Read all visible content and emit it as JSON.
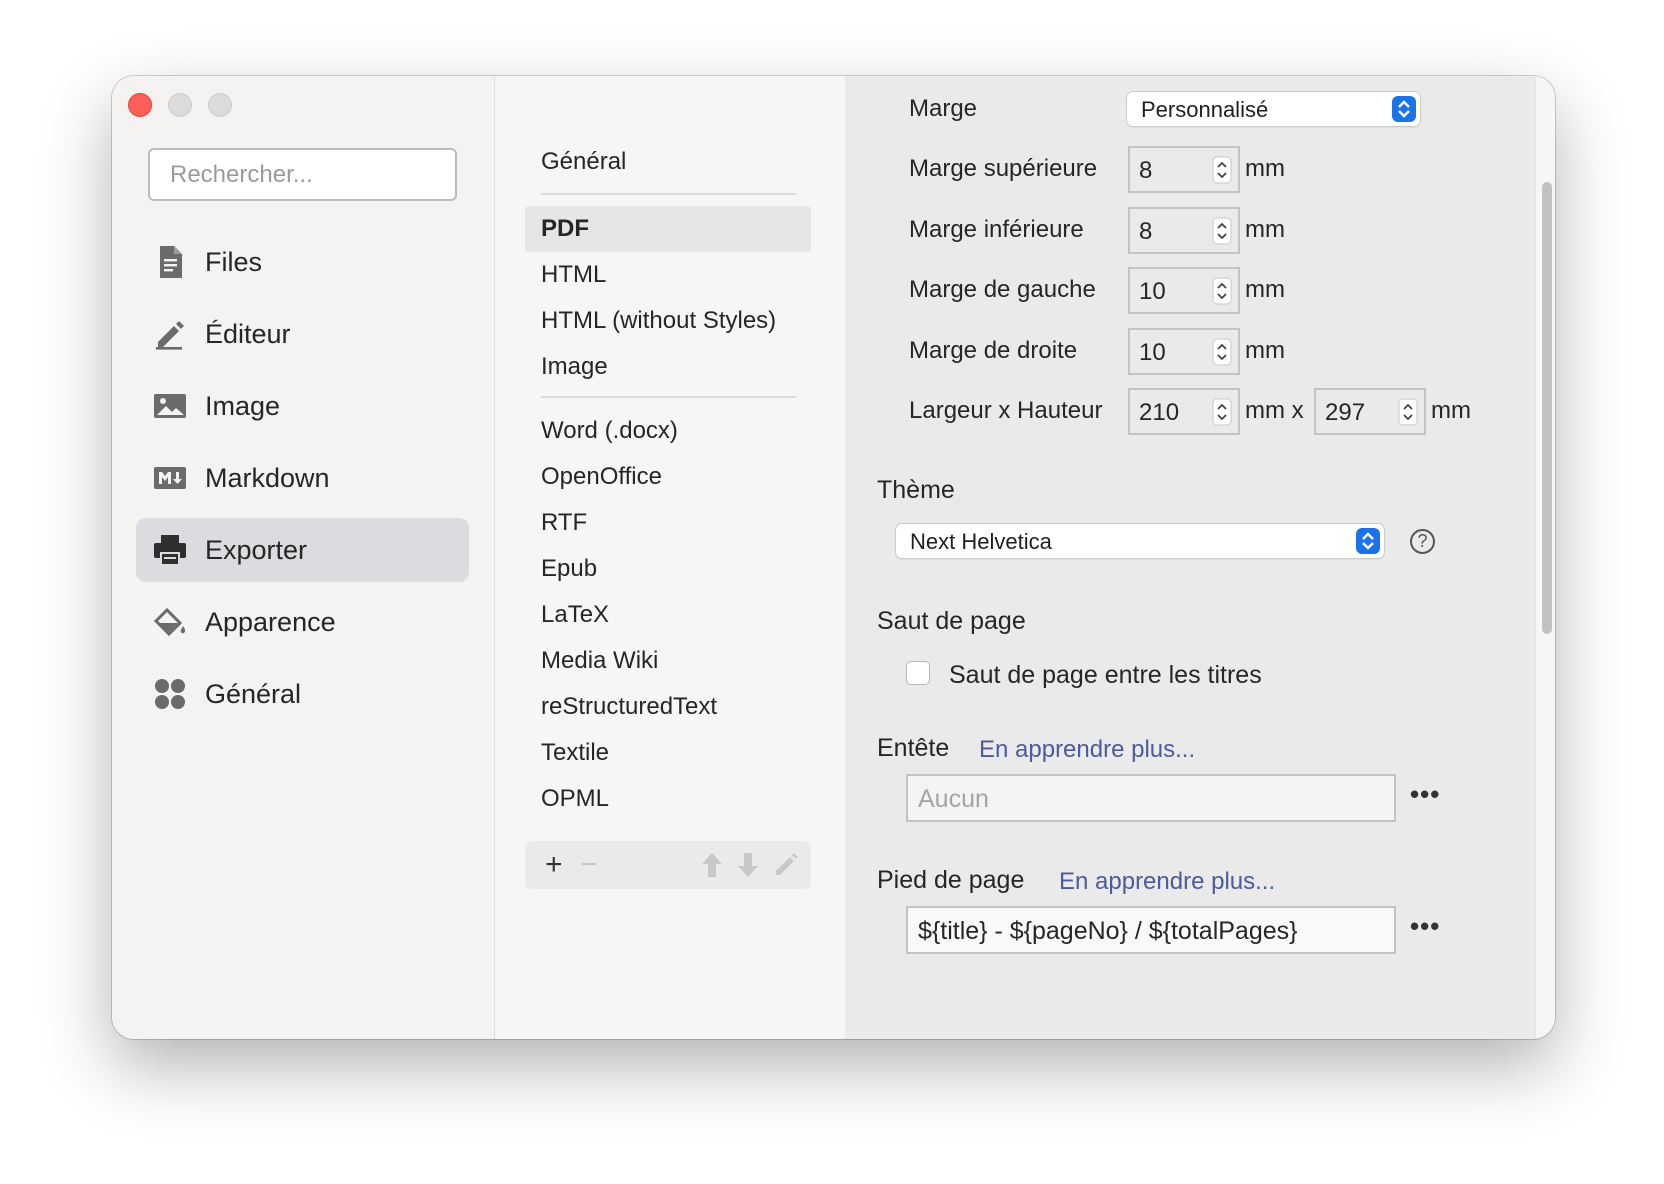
{
  "window": {
    "traffic_lights": [
      "close",
      "minimize",
      "zoom"
    ]
  },
  "sidebar": {
    "search_placeholder": "Rechercher...",
    "items": [
      {
        "label": "Files",
        "icon": "file-text-icon"
      },
      {
        "label": "Éditeur",
        "icon": "pencil-icon"
      },
      {
        "label": "Image",
        "icon": "image-icon"
      },
      {
        "label": "Markdown",
        "icon": "markdown-icon"
      },
      {
        "label": "Exporter",
        "icon": "printer-icon",
        "selected": true
      },
      {
        "label": "Apparence",
        "icon": "paint-bucket-icon"
      },
      {
        "label": "Général",
        "icon": "grid-dots-icon"
      }
    ]
  },
  "export_list": {
    "group1": [
      "Général"
    ],
    "group2": [
      "PDF",
      "HTML",
      "HTML (without Styles)",
      "Image"
    ],
    "group3": [
      "Word (.docx)",
      "OpenOffice",
      "RTF",
      "Epub",
      "LaTeX",
      "Media Wiki",
      "reStructuredText",
      "Textile",
      "OPML"
    ],
    "selected": "PDF",
    "toolbar": {
      "add": "+",
      "remove": "−"
    }
  },
  "pdf_settings": {
    "margin_label": "Marge",
    "margin_value": "Personnalisé",
    "top_label": "Marge supérieure",
    "top_value": "8",
    "bottom_label": "Marge inférieure",
    "bottom_value": "8",
    "left_label": "Marge de gauche",
    "left_value": "10",
    "right_label": "Marge de droite",
    "right_value": "10",
    "size_label": "Largeur x Hauteur",
    "width_value": "210",
    "height_value": "297",
    "unit": "mm",
    "unit_x": "mm x",
    "theme_heading": "Thème",
    "theme_value": "Next Helvetica",
    "help": "?",
    "pagebreak_heading": "Saut de page",
    "pagebreak_checkbox": "Saut de page entre les titres",
    "header_heading": "Entête",
    "header_link": "En apprendre plus...",
    "header_placeholder": "Aucun",
    "footer_heading": "Pied de page",
    "footer_link": "En apprendre plus...",
    "footer_value": "${title} - ${pageNo} / ${totalPages}",
    "more": "•••"
  },
  "colors": {
    "accent": "#1a73e8",
    "link": "#4d5a9c",
    "close": "#fe5f57",
    "selection": "#dadcdf"
  }
}
